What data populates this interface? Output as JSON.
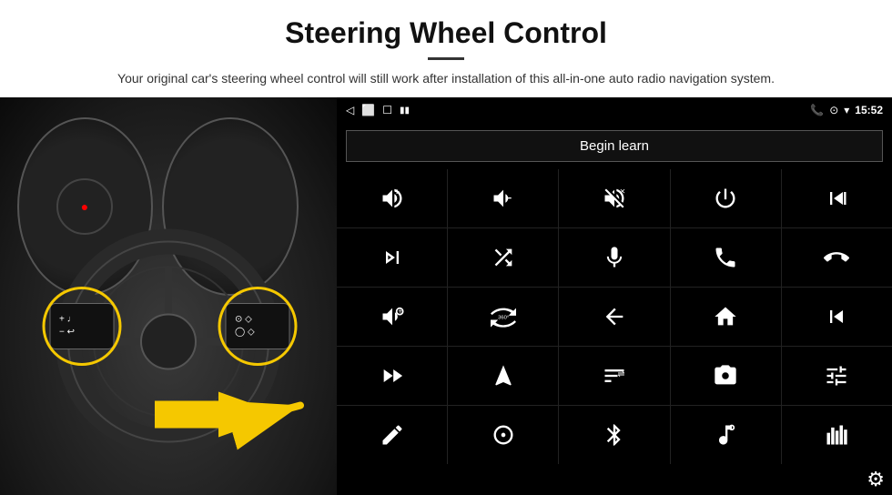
{
  "header": {
    "title": "Steering Wheel Control",
    "subtitle": "Your original car's steering wheel control will still work after installation of this all-in-one auto radio navigation system."
  },
  "status_bar": {
    "back_icon": "◁",
    "home_icon": "⬜",
    "recent_icon": "☐",
    "signal_icon": "▮▮",
    "phone_icon": "📞",
    "location_icon": "⊙",
    "wifi_icon": "▾",
    "time": "15:52"
  },
  "begin_learn": {
    "label": "Begin learn"
  },
  "controls": [
    {
      "icon": "vol_up",
      "unicode": "🔊+",
      "label": "Volume Up"
    },
    {
      "icon": "vol_down",
      "unicode": "🔉−",
      "label": "Volume Down"
    },
    {
      "icon": "mute",
      "unicode": "🔇×",
      "label": "Mute"
    },
    {
      "icon": "power",
      "unicode": "⏻",
      "label": "Power"
    },
    {
      "icon": "prev_track",
      "unicode": "⏮",
      "label": "Previous Track"
    },
    {
      "icon": "next",
      "unicode": "⏭",
      "label": "Next"
    },
    {
      "icon": "shuffle",
      "unicode": "⇄",
      "label": "Shuffle"
    },
    {
      "icon": "mic",
      "unicode": "🎤",
      "label": "Microphone"
    },
    {
      "icon": "phone",
      "unicode": "📞",
      "label": "Phone"
    },
    {
      "icon": "hang_up",
      "unicode": "📵",
      "label": "Hang Up"
    },
    {
      "icon": "horn",
      "unicode": "📢",
      "label": "Horn"
    },
    {
      "icon": "360",
      "unicode": "⊙",
      "label": "360 View"
    },
    {
      "icon": "back",
      "unicode": "↩",
      "label": "Back"
    },
    {
      "icon": "home_screen",
      "unicode": "⌂",
      "label": "Home"
    },
    {
      "icon": "skip_back",
      "unicode": "⏮⏮",
      "label": "Skip Back"
    },
    {
      "icon": "fast_fwd",
      "unicode": "⏭⏭",
      "label": "Fast Forward"
    },
    {
      "icon": "nav",
      "unicode": "▶",
      "label": "Navigation"
    },
    {
      "icon": "eq",
      "unicode": "⇌",
      "label": "EQ"
    },
    {
      "icon": "camera",
      "unicode": "📷",
      "label": "Camera"
    },
    {
      "icon": "tune",
      "unicode": "🎚",
      "label": "Tune"
    },
    {
      "icon": "pen",
      "unicode": "✏",
      "label": "Pen"
    },
    {
      "icon": "radio",
      "unicode": "◎",
      "label": "Radio"
    },
    {
      "icon": "bluetooth",
      "unicode": "₿",
      "label": "Bluetooth"
    },
    {
      "icon": "music",
      "unicode": "🎵",
      "label": "Music"
    },
    {
      "icon": "spectrum",
      "unicode": "▮▮▮",
      "label": "Spectrum"
    }
  ],
  "settings": {
    "icon": "⚙",
    "label": "Settings"
  }
}
